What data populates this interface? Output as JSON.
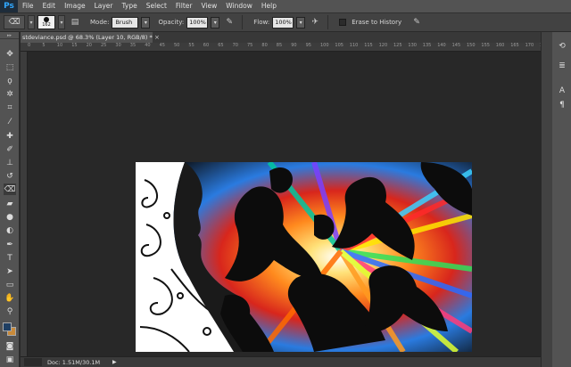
{
  "app": {
    "logo": "Ps"
  },
  "menu": [
    "File",
    "Edit",
    "Image",
    "Layer",
    "Type",
    "Select",
    "Filter",
    "View",
    "Window",
    "Help"
  ],
  "options": {
    "brush_size": "162",
    "mode_label": "Mode:",
    "mode_value": "Brush",
    "opacity_label": "Opacity:",
    "opacity_value": "100%",
    "flow_label": "Flow:",
    "flow_value": "100%",
    "erase_history_label": "Erase to History"
  },
  "document": {
    "tab_title": "stdeviance.psd @ 68.3% (Layer 10, RGB/8) *",
    "close_glyph": "×"
  },
  "ruler": {
    "ticks": [
      "0",
      "5",
      "10",
      "15",
      "20",
      "25",
      "30",
      "35",
      "40",
      "45",
      "50",
      "55",
      "60",
      "65",
      "70",
      "75",
      "80",
      "85",
      "90",
      "95",
      "100",
      "105",
      "110",
      "115",
      "120",
      "125",
      "130",
      "135",
      "140",
      "145",
      "150",
      "155",
      "160",
      "165",
      "170",
      "175"
    ]
  },
  "status": {
    "doc_info": "Doc: 1.51M/30.1M",
    "arrow": "▶"
  },
  "colors": {
    "foreground": "#1f3f63",
    "background": "#c98a3a"
  },
  "icons": {
    "tools": [
      "move-icon",
      "marquee-icon",
      "lasso-icon",
      "magic-wand-icon",
      "crop-icon",
      "eyedropper-icon",
      "healing-icon",
      "brush-icon",
      "stamp-icon",
      "history-brush-icon",
      "eraser-icon",
      "gradient-icon",
      "blur-icon",
      "dodge-icon",
      "pen-icon",
      "type-icon",
      "path-select-icon",
      "shape-icon",
      "hand-icon",
      "zoom-icon"
    ],
    "panels": [
      "history-panel-icon",
      "properties-panel-icon",
      "character-panel-icon",
      "paragraph-panel-icon"
    ]
  }
}
